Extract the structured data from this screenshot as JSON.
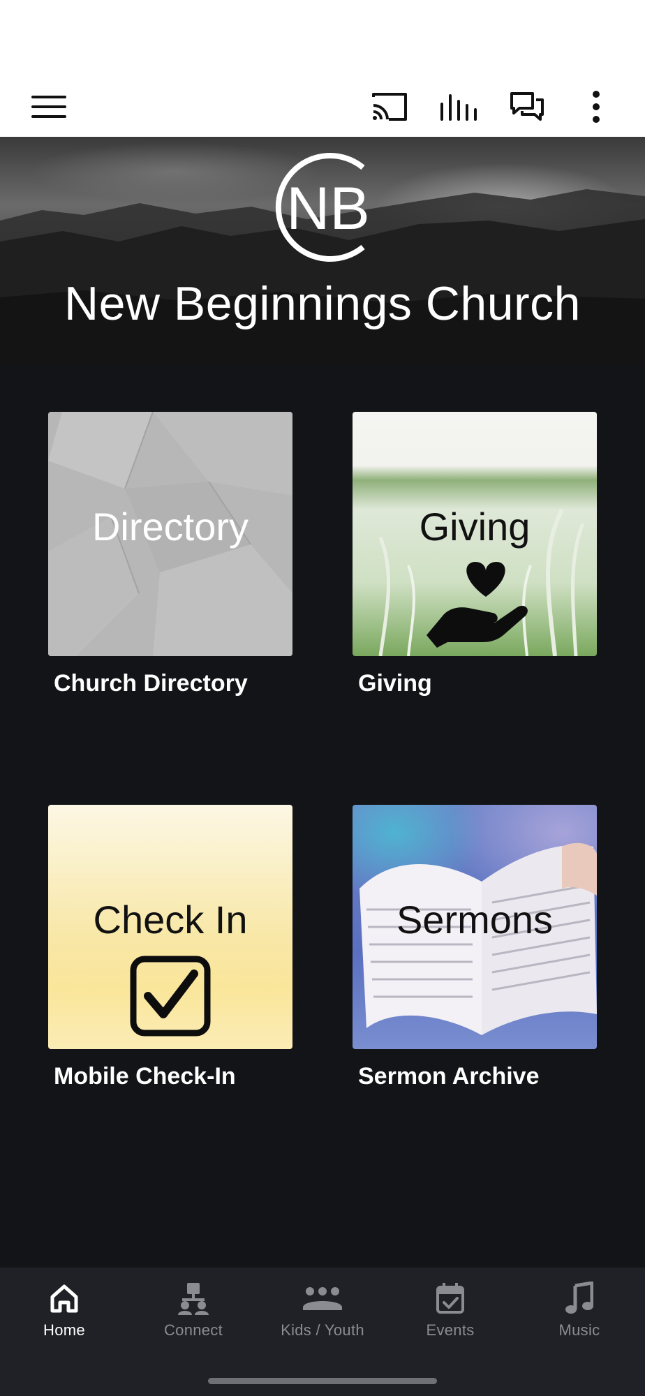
{
  "hero": {
    "logo_text": "NB",
    "title": "New Beginnings Church"
  },
  "tiles": [
    {
      "image_text": "Directory",
      "caption": "Church Directory"
    },
    {
      "image_text": "Giving",
      "caption": "Giving"
    },
    {
      "image_text": "Check In",
      "caption": "Mobile Check-In"
    },
    {
      "image_text": "Sermons",
      "caption": "Sermon Archive"
    }
  ],
  "bottom_nav": {
    "items": [
      {
        "label": "Home",
        "icon": "home-icon",
        "active": true
      },
      {
        "label": "Connect",
        "icon": "connect-icon",
        "active": false
      },
      {
        "label": "Kids / Youth",
        "icon": "group-icon",
        "active": false
      },
      {
        "label": "Events",
        "icon": "calendar-check-icon",
        "active": false
      },
      {
        "label": "Music",
        "icon": "music-note-icon",
        "active": false
      }
    ]
  },
  "colors": {
    "background": "#131417",
    "nav_background": "#1f2126",
    "nav_active": "#ffffff",
    "nav_inactive": "#8a8c91",
    "toolbar": "#ffffff"
  }
}
